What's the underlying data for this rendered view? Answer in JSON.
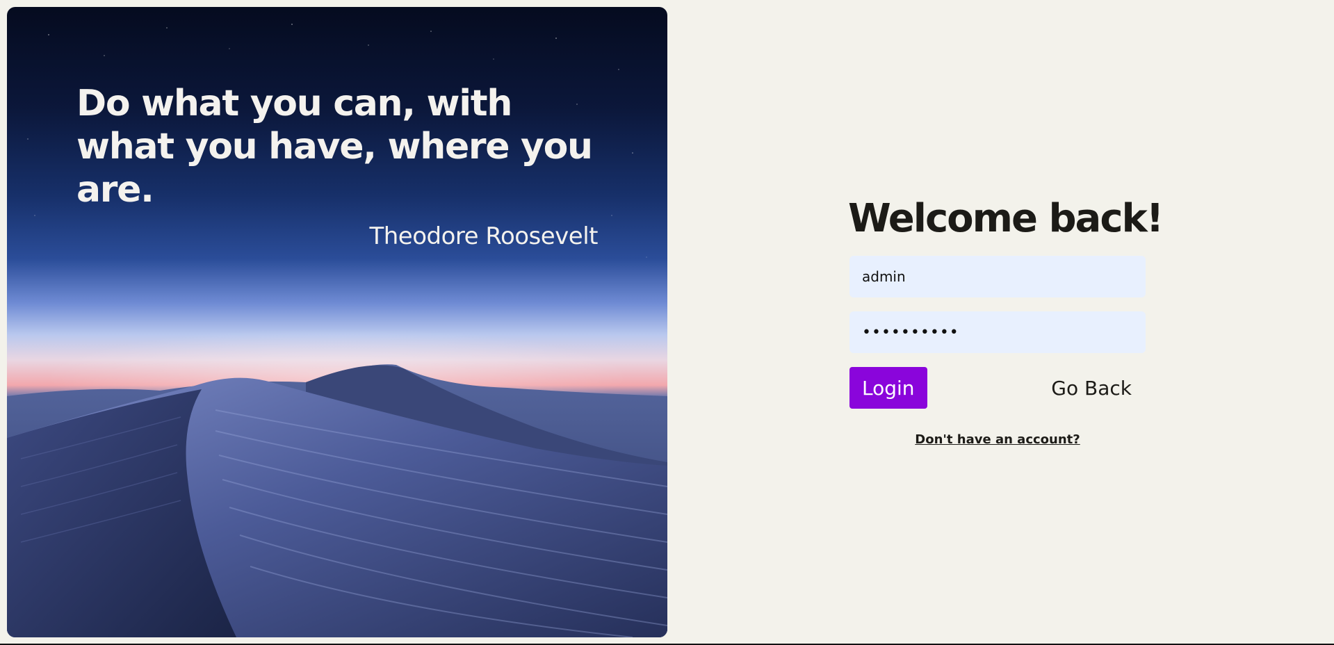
{
  "hero": {
    "quote": "Do what you can, with what you have, where you are.",
    "author": "Theodore Roosevelt",
    "image": "desert-dunes-night-sky-image"
  },
  "login": {
    "title": "Welcome back!",
    "username_value": "admin",
    "password_value": "••••••••••",
    "login_label": "Login",
    "back_label": "Go Back",
    "signup_link": "Don't have an account?"
  },
  "colors": {
    "page_background": "#f3f2eb",
    "input_background": "#e8f0fe",
    "primary_button": "#8a05db",
    "text": "#1c1b17"
  }
}
